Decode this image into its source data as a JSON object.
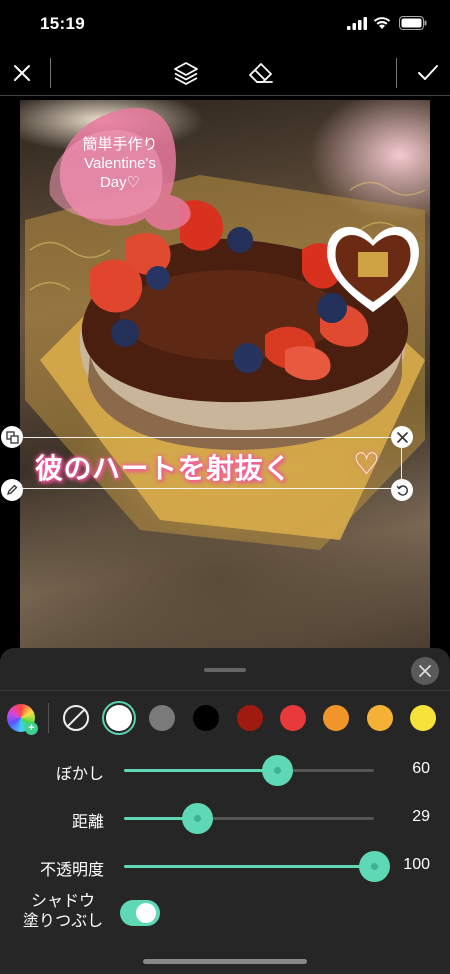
{
  "status_bar": {
    "time": "15:19"
  },
  "toolbar": {
    "close_icon": "close-icon",
    "layers_icon": "layers-icon",
    "eraser_icon": "eraser-icon",
    "confirm_icon": "checkmark-icon"
  },
  "canvas": {
    "bubble_text": [
      "簡単手作り",
      "Valentine's",
      "Day♡"
    ],
    "text_layer": {
      "text": "彼のハートを射抜く",
      "heart": "♡"
    }
  },
  "panel": {
    "colors": [
      {
        "name": "white",
        "hex": "#ffffff",
        "selected": true
      },
      {
        "name": "gray",
        "hex": "#7a7a7a"
      },
      {
        "name": "black",
        "hex": "#000000"
      },
      {
        "name": "dark-red",
        "hex": "#a01a10"
      },
      {
        "name": "red",
        "hex": "#e83a3a"
      },
      {
        "name": "orange",
        "hex": "#f0952a"
      },
      {
        "name": "amber",
        "hex": "#f4b136"
      },
      {
        "name": "yellow",
        "hex": "#f6e23a"
      }
    ],
    "sliders": [
      {
        "label": "ぼかし",
        "value": "60",
        "fraction": 0.61
      },
      {
        "label": "距離",
        "value": "29",
        "fraction": 0.29
      },
      {
        "label": "不透明度",
        "value": "100",
        "fraction": 1.0
      }
    ],
    "toggle": {
      "label_line1": "シャドウ",
      "label_line2": "塗りつぶし",
      "on": true
    },
    "accent_color": "#5fd9b5"
  }
}
